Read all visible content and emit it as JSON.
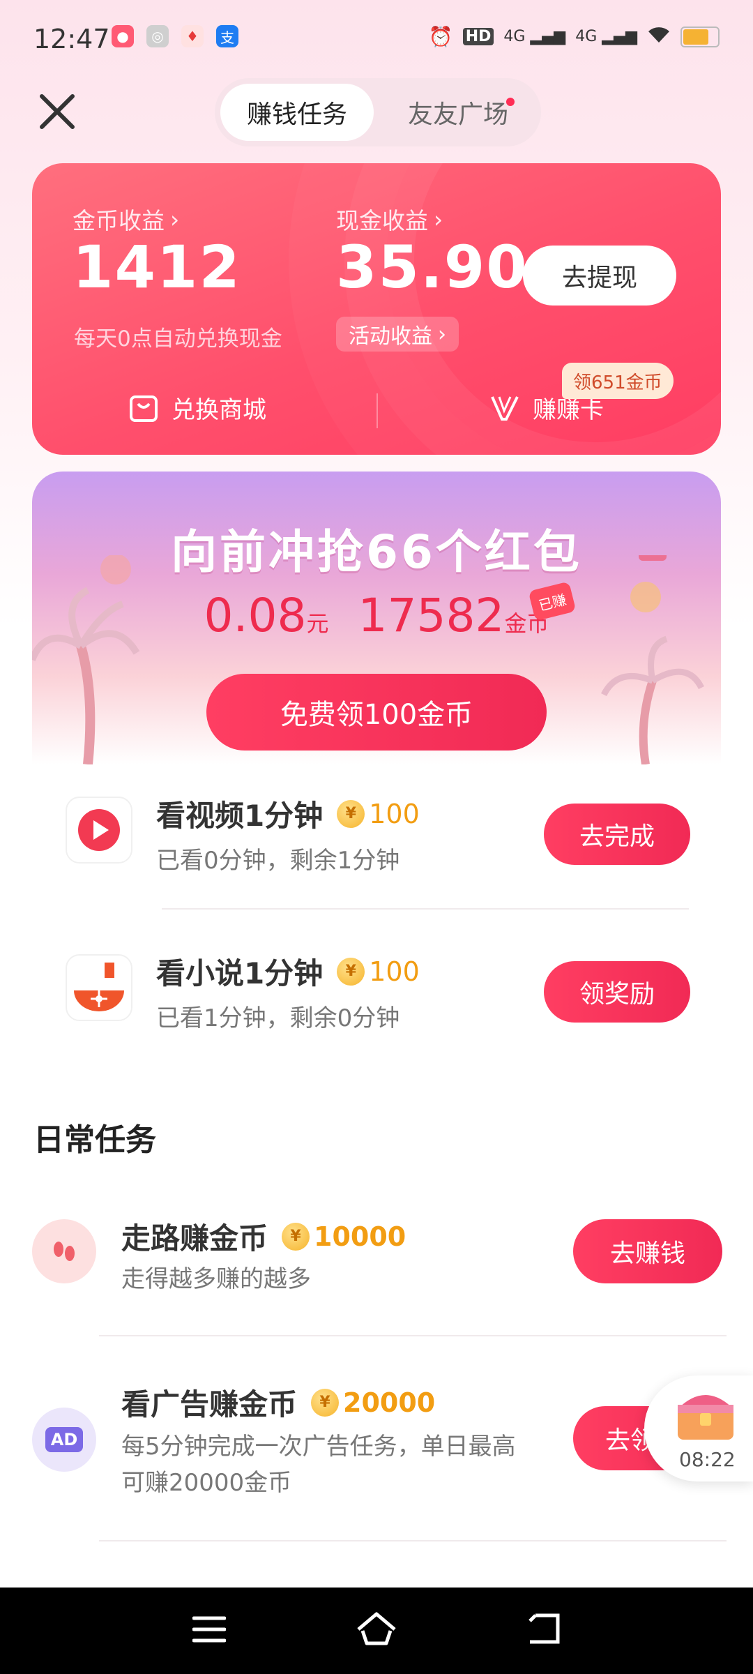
{
  "status_bar": {
    "time": "12:47",
    "indicators": [
      "alarm-icon",
      "hd-icon",
      "4g-signal-icon",
      "4g-signal-icon",
      "wifi-icon",
      "battery-icon"
    ],
    "hd_label": "HD",
    "net1": "4G",
    "net2": "4G"
  },
  "header": {
    "tabs": [
      {
        "label": "赚钱任务",
        "active": true
      },
      {
        "label": "友友广场",
        "active": false,
        "has_dot": true
      }
    ]
  },
  "earnings": {
    "coin_label": "金币收益",
    "coin_value": "1412",
    "coin_note": "每天0点自动兑换现金",
    "cash_label": "现金收益",
    "cash_value": "35.90",
    "withdraw_label": "去提现",
    "activity_label": "活动收益",
    "shop_label": "兑换商城",
    "card_label": "赚赚卡",
    "card_badge": "领651金币"
  },
  "red_packet": {
    "title": "向前冲抢66个红包",
    "cash_amount": "0.08",
    "cash_unit": "元",
    "coin_amount": "17582",
    "coin_unit": "金币",
    "earned_tag": "已赚",
    "free_button": "免费领100金币"
  },
  "tasks": [
    {
      "title": "看视频1分钟",
      "coins": "100",
      "subtitle": "已看0分钟，剩余1分钟",
      "button": "去完成"
    },
    {
      "title": "看小说1分钟",
      "coins": "100",
      "subtitle": "已看1分钟，剩余0分钟",
      "button": "领奖励"
    }
  ],
  "daily": {
    "heading": "日常任务",
    "items": [
      {
        "title": "走路赚金币",
        "coins": "10000",
        "subtitle": "走得越多赚的越多",
        "button": "去赚钱"
      },
      {
        "title": "看广告赚金币",
        "coins": "20000",
        "subtitle_line1": "每5分钟完成一次广告任务，单日最高",
        "subtitle_line2": "可赚20000金币",
        "button": "去领",
        "icon_text": "AD"
      }
    ]
  },
  "floating_chest": {
    "timer": "08:22"
  },
  "colors": {
    "accent": "#f12a55",
    "coin": "#f29d12",
    "card": "#ff4f6c"
  }
}
